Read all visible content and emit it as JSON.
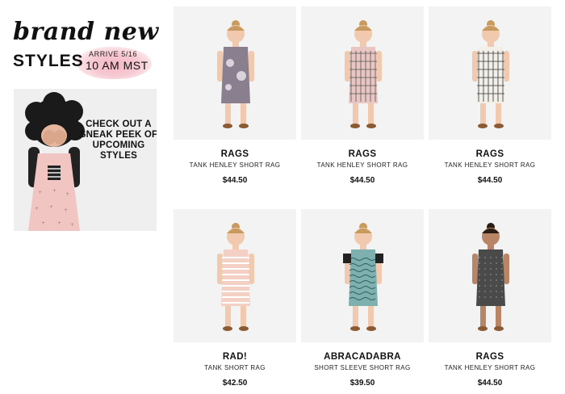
{
  "promo": {
    "script_title": "brand new",
    "styles_title": "STYLES",
    "arrive_line1": "ARRIVE 5/16",
    "arrive_line2": "10 AM MST",
    "sneak_text": "CHECK OUT A SNEAK PEEK OF UPCOMING STYLES"
  },
  "products": [
    {
      "brand": "RAGS",
      "name": "TANK HENLEY SHORT RAG",
      "price": "$44.50",
      "outfit": "#8a7f8e",
      "pattern": "floral"
    },
    {
      "brand": "RAGS",
      "name": "TANK HENLEY SHORT RAG",
      "price": "$44.50",
      "outfit": "#e9c6c4",
      "pattern": "grid"
    },
    {
      "brand": "RAGS",
      "name": "TANK HENLEY SHORT RAG",
      "price": "$44.50",
      "outfit": "#f2efe8",
      "pattern": "grid-dark"
    },
    {
      "brand": "RAD!",
      "name": "TANK SHORT RAG",
      "price": "$42.50",
      "outfit": "#f4cfc4",
      "pattern": "stripe"
    },
    {
      "brand": "ABRACADABRA",
      "name": "SHORT SLEEVE SHORT RAG",
      "price": "$39.50",
      "outfit": "#7fb0b0",
      "pattern": "wave"
    },
    {
      "brand": "RAGS",
      "name": "TANK HENLEY SHORT RAG",
      "price": "$44.50",
      "outfit": "#4a4a4a",
      "pattern": "dots"
    }
  ]
}
